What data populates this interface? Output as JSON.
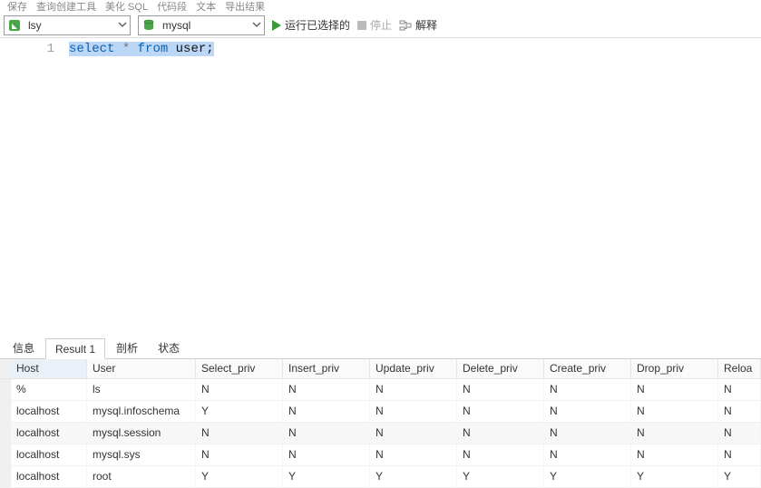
{
  "topbar": {
    "items": [
      "保存",
      "查询创建工具",
      "美化 SQL",
      "代码段",
      "文本",
      "导出结果"
    ]
  },
  "toolbar": {
    "connection_value": "lsy",
    "database_value": "mysql",
    "run_label": "运行已选择的",
    "stop_label": "停止",
    "explain_label": "解释"
  },
  "editor": {
    "line_no": "1",
    "sql": {
      "kw_select": "select",
      "star": "*",
      "kw_from": "from",
      "ident": "user",
      "semi": ";"
    }
  },
  "tabs": {
    "info": "信息",
    "result": "Result 1",
    "profile": "剖析",
    "status": "状态"
  },
  "grid": {
    "headers": [
      "Host",
      "User",
      "Select_priv",
      "Insert_priv",
      "Update_priv",
      "Delete_priv",
      "Create_priv",
      "Drop_priv",
      "Reloa"
    ],
    "rows": [
      {
        "mark": true,
        "cells": [
          "%",
          "ls",
          "N",
          "N",
          "N",
          "N",
          "N",
          "N",
          "N"
        ]
      },
      {
        "mark": false,
        "cells": [
          "localhost",
          "mysql.infoschema",
          "Y",
          "N",
          "N",
          "N",
          "N",
          "N",
          "N"
        ]
      },
      {
        "mark": false,
        "cells": [
          "localhost",
          "mysql.session",
          "N",
          "N",
          "N",
          "N",
          "N",
          "N",
          "N"
        ]
      },
      {
        "mark": false,
        "cells": [
          "localhost",
          "mysql.sys",
          "N",
          "N",
          "N",
          "N",
          "N",
          "N",
          "N"
        ]
      },
      {
        "mark": false,
        "cells": [
          "localhost",
          "root",
          "Y",
          "Y",
          "Y",
          "Y",
          "Y",
          "Y",
          "Y"
        ]
      }
    ]
  }
}
